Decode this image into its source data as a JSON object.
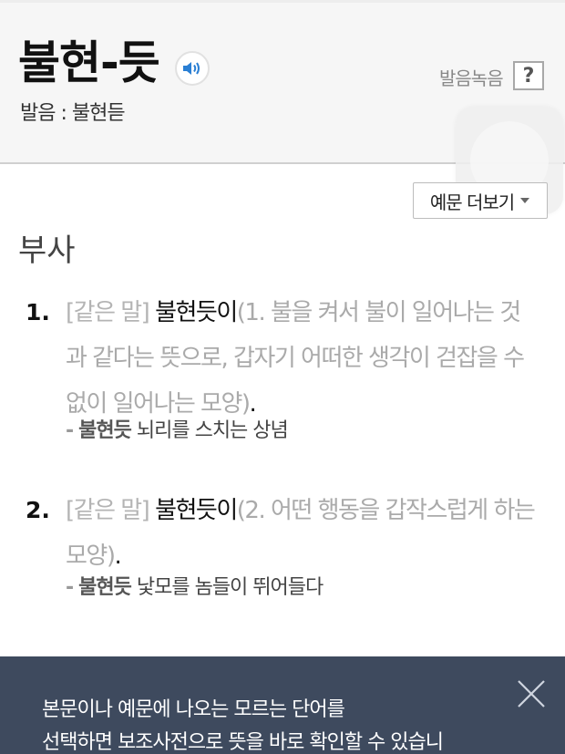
{
  "entry": {
    "headword": "불현-듯",
    "pronunciation": "발음 : 불현듣",
    "record_label": "발음녹음",
    "help_label": "?"
  },
  "more_examples_label": "예문 더보기",
  "part_of_speech": "부사",
  "senses": [
    {
      "number": "1.",
      "synonym_tag": "[같은 말]",
      "synonym": "불현듯이",
      "definition": "(1. 불을 켜서 불이 일어나는 것과 같다는 뜻으로, 갑자기 어떠한 생각이 걷잡을 수 없이 일어나는 모양)",
      "end": ".",
      "example_dash": "-",
      "example_head": "불현듯",
      "example_rest": " 뇌리를 스치는 상념"
    },
    {
      "number": "2.",
      "synonym_tag": "[같은 말]",
      "synonym": "불현듯이",
      "definition": "(2. 어떤 행동을 갑작스럽게 하는 모양)",
      "end": ".",
      "example_dash": "-",
      "example_head": "불현듯",
      "example_rest": " 낯모를 놈들이 뛰어들다"
    }
  ],
  "toast": {
    "line1": "본문이나 예문에 나오는 모르는 단어를",
    "line2": "선택하면 보조사전으로 뜻을 바로 확인할 수 있습니"
  },
  "colors": {
    "header_bg": "#f6f6f6",
    "toast_bg": "#3e4a5e",
    "speaker_blue": "#2a7fd4"
  },
  "icons": [
    "speaker-icon",
    "dropdown-arrow-icon",
    "close-icon"
  ]
}
